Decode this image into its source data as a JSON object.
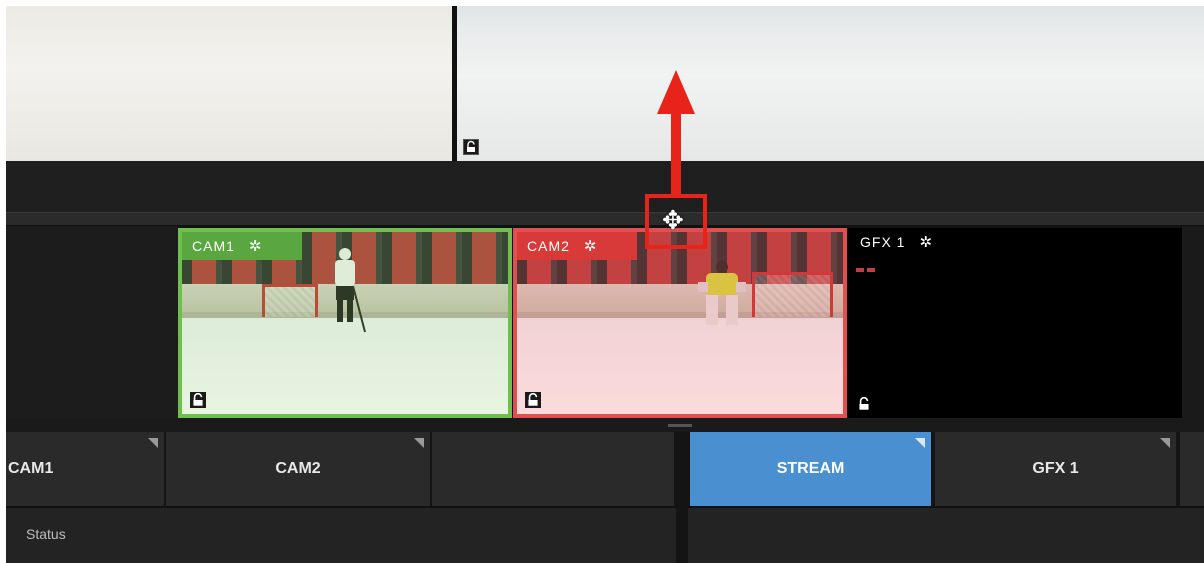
{
  "top_previews": {
    "left": {
      "lock_icon": "unlock-icon"
    },
    "right": {
      "lock_icon": "unlock-icon"
    }
  },
  "sources": [
    {
      "label": "CAM1",
      "color": "#5aa640",
      "icon": "gear-icon",
      "lock": "unlock-icon"
    },
    {
      "label": "CAM2",
      "color": "#d83a3a",
      "icon": "gear-icon",
      "lock": "unlock-icon"
    },
    {
      "label": "GFX 1",
      "color": "#000000",
      "icon": "gear-icon",
      "lock": "unlock-icon"
    }
  ],
  "buttons_left": [
    {
      "label": "CAM1"
    },
    {
      "label": "CAM2"
    },
    {
      "label": ""
    }
  ],
  "buttons_right": [
    {
      "label": "STREAM",
      "color": "#4a8fd0"
    },
    {
      "label": "GFX 1"
    }
  ],
  "status": {
    "label": "Status"
  },
  "annotation": {
    "icon": "move-icon",
    "arrow_color": "#e8231a"
  }
}
